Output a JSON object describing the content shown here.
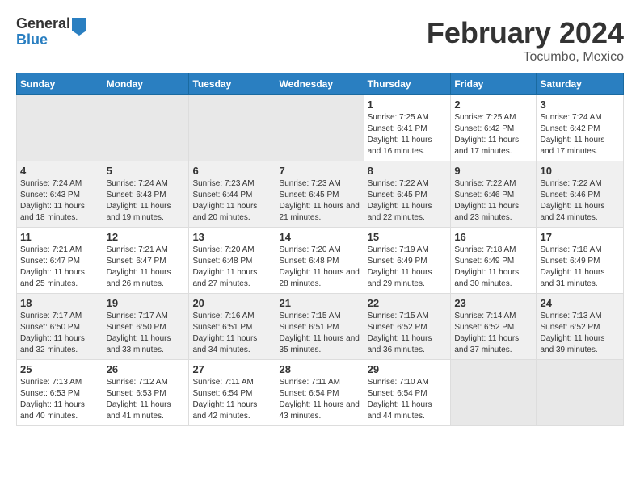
{
  "logo": {
    "text_top": "General",
    "text_bottom": "Blue"
  },
  "title": "February 2024",
  "subtitle": "Tocumbo, Mexico",
  "days_of_week": [
    "Sunday",
    "Monday",
    "Tuesday",
    "Wednesday",
    "Thursday",
    "Friday",
    "Saturday"
  ],
  "weeks": [
    [
      {
        "day": "",
        "empty": true
      },
      {
        "day": "",
        "empty": true
      },
      {
        "day": "",
        "empty": true
      },
      {
        "day": "",
        "empty": true
      },
      {
        "day": "1",
        "sunrise": "7:25 AM",
        "sunset": "6:41 PM",
        "daylight": "11 hours and 16 minutes."
      },
      {
        "day": "2",
        "sunrise": "7:25 AM",
        "sunset": "6:42 PM",
        "daylight": "11 hours and 17 minutes."
      },
      {
        "day": "3",
        "sunrise": "7:24 AM",
        "sunset": "6:42 PM",
        "daylight": "11 hours and 17 minutes."
      }
    ],
    [
      {
        "day": "4",
        "sunrise": "7:24 AM",
        "sunset": "6:43 PM",
        "daylight": "11 hours and 18 minutes."
      },
      {
        "day": "5",
        "sunrise": "7:24 AM",
        "sunset": "6:43 PM",
        "daylight": "11 hours and 19 minutes."
      },
      {
        "day": "6",
        "sunrise": "7:23 AM",
        "sunset": "6:44 PM",
        "daylight": "11 hours and 20 minutes."
      },
      {
        "day": "7",
        "sunrise": "7:23 AM",
        "sunset": "6:45 PM",
        "daylight": "11 hours and 21 minutes."
      },
      {
        "day": "8",
        "sunrise": "7:22 AM",
        "sunset": "6:45 PM",
        "daylight": "11 hours and 22 minutes."
      },
      {
        "day": "9",
        "sunrise": "7:22 AM",
        "sunset": "6:46 PM",
        "daylight": "11 hours and 23 minutes."
      },
      {
        "day": "10",
        "sunrise": "7:22 AM",
        "sunset": "6:46 PM",
        "daylight": "11 hours and 24 minutes."
      }
    ],
    [
      {
        "day": "11",
        "sunrise": "7:21 AM",
        "sunset": "6:47 PM",
        "daylight": "11 hours and 25 minutes."
      },
      {
        "day": "12",
        "sunrise": "7:21 AM",
        "sunset": "6:47 PM",
        "daylight": "11 hours and 26 minutes."
      },
      {
        "day": "13",
        "sunrise": "7:20 AM",
        "sunset": "6:48 PM",
        "daylight": "11 hours and 27 minutes."
      },
      {
        "day": "14",
        "sunrise": "7:20 AM",
        "sunset": "6:48 PM",
        "daylight": "11 hours and 28 minutes."
      },
      {
        "day": "15",
        "sunrise": "7:19 AM",
        "sunset": "6:49 PM",
        "daylight": "11 hours and 29 minutes."
      },
      {
        "day": "16",
        "sunrise": "7:18 AM",
        "sunset": "6:49 PM",
        "daylight": "11 hours and 30 minutes."
      },
      {
        "day": "17",
        "sunrise": "7:18 AM",
        "sunset": "6:49 PM",
        "daylight": "11 hours and 31 minutes."
      }
    ],
    [
      {
        "day": "18",
        "sunrise": "7:17 AM",
        "sunset": "6:50 PM",
        "daylight": "11 hours and 32 minutes."
      },
      {
        "day": "19",
        "sunrise": "7:17 AM",
        "sunset": "6:50 PM",
        "daylight": "11 hours and 33 minutes."
      },
      {
        "day": "20",
        "sunrise": "7:16 AM",
        "sunset": "6:51 PM",
        "daylight": "11 hours and 34 minutes."
      },
      {
        "day": "21",
        "sunrise": "7:15 AM",
        "sunset": "6:51 PM",
        "daylight": "11 hours and 35 minutes."
      },
      {
        "day": "22",
        "sunrise": "7:15 AM",
        "sunset": "6:52 PM",
        "daylight": "11 hours and 36 minutes."
      },
      {
        "day": "23",
        "sunrise": "7:14 AM",
        "sunset": "6:52 PM",
        "daylight": "11 hours and 37 minutes."
      },
      {
        "day": "24",
        "sunrise": "7:13 AM",
        "sunset": "6:52 PM",
        "daylight": "11 hours and 39 minutes."
      }
    ],
    [
      {
        "day": "25",
        "sunrise": "7:13 AM",
        "sunset": "6:53 PM",
        "daylight": "11 hours and 40 minutes."
      },
      {
        "day": "26",
        "sunrise": "7:12 AM",
        "sunset": "6:53 PM",
        "daylight": "11 hours and 41 minutes."
      },
      {
        "day": "27",
        "sunrise": "7:11 AM",
        "sunset": "6:54 PM",
        "daylight": "11 hours and 42 minutes."
      },
      {
        "day": "28",
        "sunrise": "7:11 AM",
        "sunset": "6:54 PM",
        "daylight": "11 hours and 43 minutes."
      },
      {
        "day": "29",
        "sunrise": "7:10 AM",
        "sunset": "6:54 PM",
        "daylight": "11 hours and 44 minutes."
      },
      {
        "day": "",
        "empty": true
      },
      {
        "day": "",
        "empty": true
      }
    ]
  ],
  "labels": {
    "sunrise_prefix": "Sunrise: ",
    "sunset_prefix": "Sunset: ",
    "daylight_prefix": "Daylight: "
  }
}
